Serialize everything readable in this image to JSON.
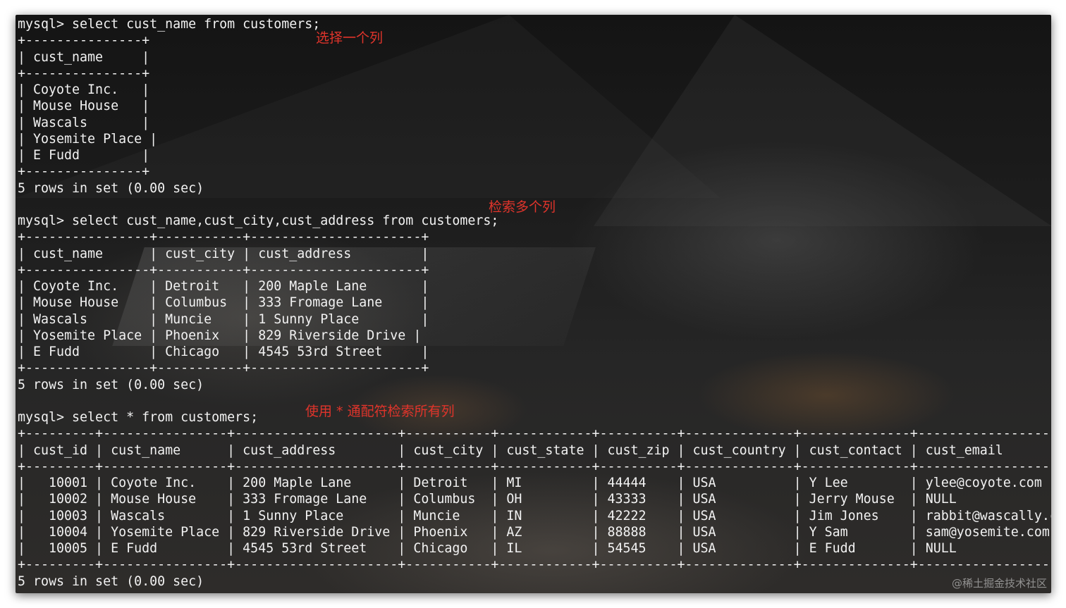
{
  "terminal": {
    "lines": [
      "mysql> select cust_name from customers;",
      "+---------------+",
      "| cust_name     |",
      "+---------------+",
      "| Coyote Inc.   |",
      "| Mouse House   |",
      "| Wascals       |",
      "| Yosemite Place |",
      "| E Fudd        |",
      "+---------------+",
      "5 rows in set (0.00 sec)",
      "",
      "mysql> select cust_name,cust_city,cust_address from customers;",
      "+----------------+-----------+----------------------+",
      "| cust_name      | cust_city | cust_address         |",
      "+----------------+-----------+----------------------+",
      "| Coyote Inc.    | Detroit   | 200 Maple Lane       |",
      "| Mouse House    | Columbus  | 333 Fromage Lane     |",
      "| Wascals        | Muncie    | 1 Sunny Place        |",
      "| Yosemite Place | Phoenix   | 829 Riverside Drive |",
      "| E Fudd         | Chicago   | 4545 53rd Street     |",
      "+----------------+-----------+----------------------+",
      "5 rows in set (0.00 sec)",
      "",
      "mysql> select * from customers;",
      "+---------+----------------+---------------------+-----------+------------+----------+--------------+--------------+---------------------+",
      "| cust_id | cust_name      | cust_address        | cust_city | cust_state | cust_zip | cust_country | cust_contact | cust_email          |",
      "+---------+----------------+---------------------+-----------+------------+----------+--------------+--------------+---------------------+",
      "|   10001 | Coyote Inc.    | 200 Maple Lane      | Detroit   | MI         | 44444    | USA          | Y Lee        | ylee@coyote.com     |",
      "|   10002 | Mouse House    | 333 Fromage Lane    | Columbus  | OH         | 43333    | USA          | Jerry Mouse  | NULL                |",
      "|   10003 | Wascals        | 1 Sunny Place       | Muncie    | IN         | 42222    | USA          | Jim Jones    | rabbit@wascally.com |",
      "|   10004 | Yosemite Place | 829 Riverside Drive | Phoenix   | AZ         | 88888    | USA          | Y Sam        | sam@yosemite.com    |",
      "|   10005 | E Fudd         | 4545 53rd Street    | Chicago   | IL         | 54545    | USA          | E Fudd       | NULL                |",
      "+---------+----------------+---------------------+-----------+------------+----------+--------------+--------------+---------------------+",
      "5 rows in set (0.00 sec)"
    ]
  },
  "annotations": {
    "select_one": "选择一个列",
    "select_multiple": "检索多个列",
    "select_all": "使用 * 通配符检索所有列"
  },
  "watermark": "@稀土掘金技术社区",
  "colors": {
    "annotation": "#e0342b",
    "terminal_text": "#f2f2f2"
  }
}
